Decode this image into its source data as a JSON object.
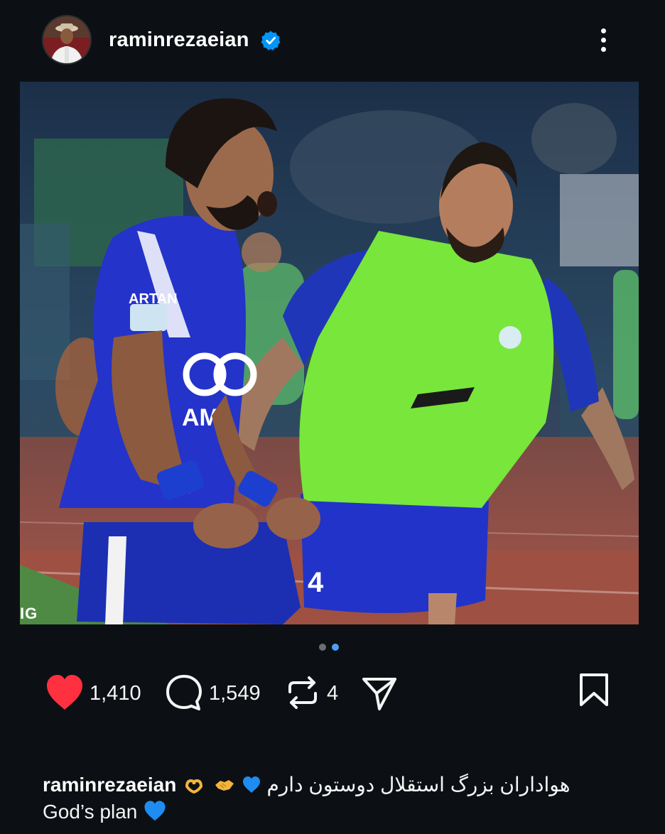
{
  "post": {
    "username": "raminrezaeian",
    "verified": true,
    "carousel": {
      "total": 2,
      "current": 2
    },
    "photo_watermark": "IG",
    "actions": {
      "likes": "1,410",
      "comments": "1,549",
      "reposts": "4"
    },
    "caption": {
      "username": "raminrezaeian",
      "line1": "هواداران بزرگ استقلال دوستون دارم",
      "line2": "God’s plan"
    }
  },
  "icons": {
    "like": "heart-filled-icon",
    "comment": "speech-bubble-icon",
    "repost": "repost-icon",
    "share": "paper-plane-icon",
    "save": "bookmark-icon",
    "more": "more-vertical-icon",
    "verified": "verified-badge-icon"
  },
  "colors": {
    "background": "#0c1014",
    "like_red": "#ff3040",
    "verified_blue": "#0095f6",
    "dot_active": "#4c9ff7",
    "dot_inactive": "#8e8e8e"
  }
}
